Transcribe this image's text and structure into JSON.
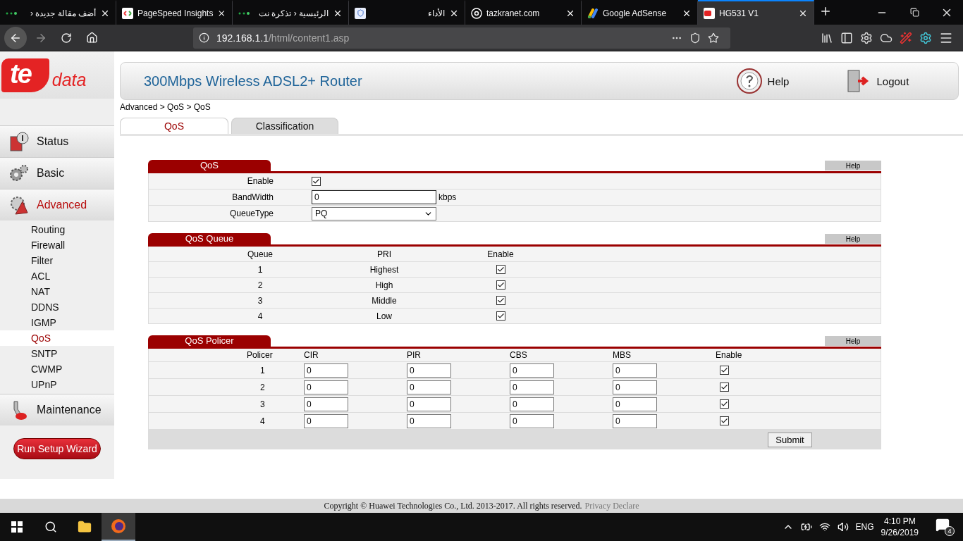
{
  "browser": {
    "tabs": [
      {
        "title": "أضف مقالة جديدة ‹",
        "selected": false,
        "kind": "dots"
      },
      {
        "title": "PageSpeed Insights",
        "selected": false,
        "kind": "speed"
      },
      {
        "title": "الرئيسية ‹ تذكرة نت",
        "selected": false,
        "kind": "dots"
      },
      {
        "title": "الأداء",
        "selected": false,
        "kind": "case"
      },
      {
        "title": "tazkranet.com",
        "selected": false,
        "kind": "at"
      },
      {
        "title": "Google AdSense",
        "selected": false,
        "kind": "ads"
      },
      {
        "title": "HG531 V1",
        "selected": true,
        "kind": "router"
      }
    ],
    "url": {
      "host": "192.168.1.1",
      "path": "/html/content1.asp"
    }
  },
  "logo": {
    "brand": "te",
    "sub": "data"
  },
  "header": {
    "title": "300Mbps Wireless ADSL2+ Router",
    "help": "Help",
    "logout": "Logout"
  },
  "breadcrumb": "Advanced > QoS > QoS",
  "page_tabs": [
    {
      "label": "QoS",
      "selected": true
    },
    {
      "label": "Classification",
      "selected": false
    }
  ],
  "sidebar": {
    "items": [
      {
        "label": "Status",
        "kind": "status",
        "selected": false
      },
      {
        "label": "Basic",
        "kind": "basic",
        "selected": false
      },
      {
        "label": "Advanced",
        "kind": "advanced",
        "selected": true,
        "children": [
          {
            "label": "Routing",
            "selected": false
          },
          {
            "label": "Firewall",
            "selected": false
          },
          {
            "label": "Filter",
            "selected": false
          },
          {
            "label": "ACL",
            "selected": false
          },
          {
            "label": "NAT",
            "selected": false
          },
          {
            "label": "DDNS",
            "selected": false
          },
          {
            "label": "IGMP",
            "selected": false
          },
          {
            "label": "QoS",
            "selected": true
          },
          {
            "label": "SNTP",
            "selected": false
          },
          {
            "label": "CWMP",
            "selected": false
          },
          {
            "label": "UPnP",
            "selected": false
          }
        ]
      },
      {
        "label": "Maintenance",
        "kind": "maintenance",
        "selected": false
      }
    ],
    "wizard": "Run Setup Wizard"
  },
  "qos": {
    "title": "QoS",
    "help": "Help",
    "enable": {
      "label": "Enable",
      "checked": true
    },
    "bandwidth": {
      "label": "BandWidth",
      "value": "0",
      "unit": "kbps"
    },
    "queue_type": {
      "label": "QueueType",
      "value": "PQ"
    }
  },
  "qos_queue": {
    "title": "QoS Queue",
    "help": "Help",
    "columns": [
      "Queue",
      "PRI",
      "Enable"
    ],
    "rows": [
      {
        "queue": "1",
        "pri": "Highest",
        "enabled": true
      },
      {
        "queue": "2",
        "pri": "High",
        "enabled": true
      },
      {
        "queue": "3",
        "pri": "Middle",
        "enabled": true
      },
      {
        "queue": "4",
        "pri": "Low",
        "enabled": true
      }
    ]
  },
  "qos_policer": {
    "title": "QoS Policer",
    "help": "Help",
    "columns": [
      "Policer",
      "CIR",
      "PIR",
      "CBS",
      "MBS",
      "Enable"
    ],
    "rows": [
      {
        "policer": "1",
        "cir": "0",
        "pir": "0",
        "cbs": "0",
        "mbs": "0",
        "enabled": true
      },
      {
        "policer": "2",
        "cir": "0",
        "pir": "0",
        "cbs": "0",
        "mbs": "0",
        "enabled": true
      },
      {
        "policer": "3",
        "cir": "0",
        "pir": "0",
        "cbs": "0",
        "mbs": "0",
        "enabled": true
      },
      {
        "policer": "4",
        "cir": "0",
        "pir": "0",
        "cbs": "0",
        "mbs": "0",
        "enabled": true
      }
    ],
    "submit": "Submit"
  },
  "footer": {
    "copyright": "Copyright © Huawei Technologies Co., Ltd. 2013-2017. All rights reserved.",
    "link": "Privacy Declare"
  },
  "taskbar": {
    "language": "ENG",
    "time": "4:10 PM",
    "date": "9/26/2019",
    "notifications": "4"
  }
}
